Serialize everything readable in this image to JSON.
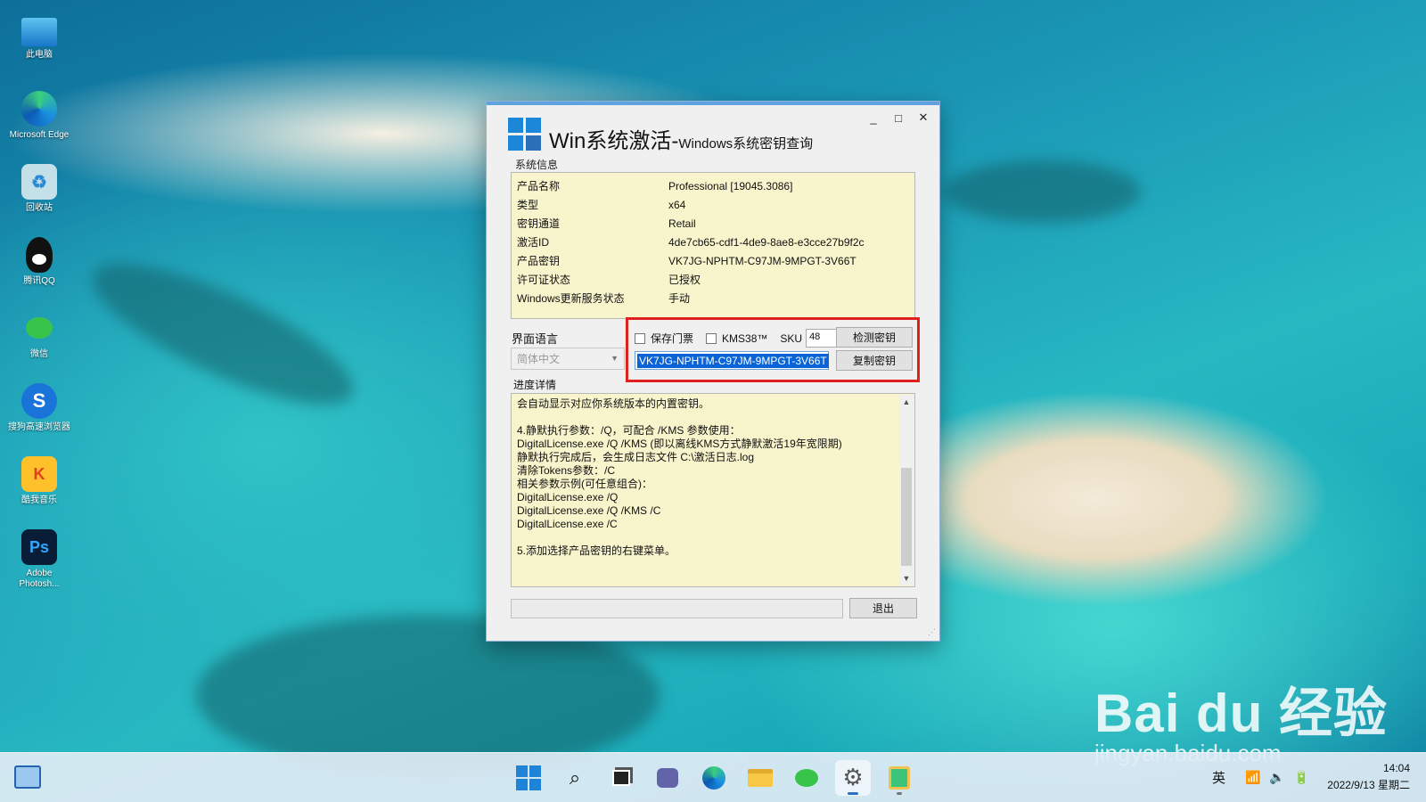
{
  "desktop": {
    "icons": [
      {
        "label": "此电脑",
        "icon": "monitor-icon"
      },
      {
        "label": "Microsoft Edge",
        "icon": "edge-icon"
      },
      {
        "label": "回收站",
        "icon": "recycle-bin-icon"
      },
      {
        "label": "腾讯QQ",
        "icon": "qq-icon"
      },
      {
        "label": "微信",
        "icon": "wechat-icon"
      },
      {
        "label": "搜狗高速浏览器",
        "icon": "sogou-browser-icon"
      },
      {
        "label": "酷我音乐",
        "icon": "kuwo-music-icon"
      },
      {
        "label": "Adobe Photosh...",
        "icon": "photoshop-icon",
        "glyph": "Ps"
      }
    ]
  },
  "window": {
    "title_main": "Win系统激活-",
    "title_sub": "Windows系统密钥查询",
    "controls": {
      "minimize": "_",
      "maximize": "□",
      "close": "✕"
    },
    "system_info": {
      "label": "系统信息",
      "rows": [
        {
          "key": "产品名称",
          "value": "Professional [19045.3086]"
        },
        {
          "key": "类型",
          "value": "x64"
        },
        {
          "key": "密钥通道",
          "value": "Retail"
        },
        {
          "key": "激活ID",
          "value": "4de7cb65-cdf1-4de9-8ae8-e3cce27b9f2c"
        },
        {
          "key": "产品密钥",
          "value": "VK7JG-NPHTM-C97JM-9MPGT-3V66T"
        },
        {
          "key": "许可证状态",
          "value": "已授权"
        },
        {
          "key": "Windows更新服务状态",
          "value": "手动"
        }
      ]
    },
    "language": {
      "label": "界面语言",
      "selected": "简体中文"
    },
    "options": {
      "keep_ticket_label": "保存门票",
      "kms38_label": "KMS38™",
      "sku_label": "SKU",
      "sku_value": "48",
      "check_key_button": "检测密钥",
      "copy_key_button": "复制密钥",
      "key_value": "VK7JG-NPHTM-C97JM-9MPGT-3V66T"
    },
    "progress": {
      "label": "进度详情",
      "lines": [
        "会自动显示对应你系统版本的内置密钥。",
        "",
        "4.静默执行参数：/Q，可配合 /KMS 参数使用：",
        "DigitalLicense.exe /Q /KMS (即以离线KMS方式静默激活19年宽限期)",
        "静默执行完成后，会生成日志文件 C:\\激活日志.log",
        "清除Tokens参数：/C",
        "相关参数示例(可任意组合)：",
        "DigitalLicense.exe /Q",
        "DigitalLicense.exe /Q /KMS /C",
        "DigitalLicense.exe /C",
        "",
        "5.添加选择产品密钥的右键菜单。"
      ]
    },
    "exit_button": "退出"
  },
  "taskbar": {
    "ime": "英",
    "time": "14:04",
    "date": "2022/9/13 星期二"
  },
  "watermark": {
    "brand": "Bai du 经验",
    "url": "jingyan.baidu.com"
  }
}
